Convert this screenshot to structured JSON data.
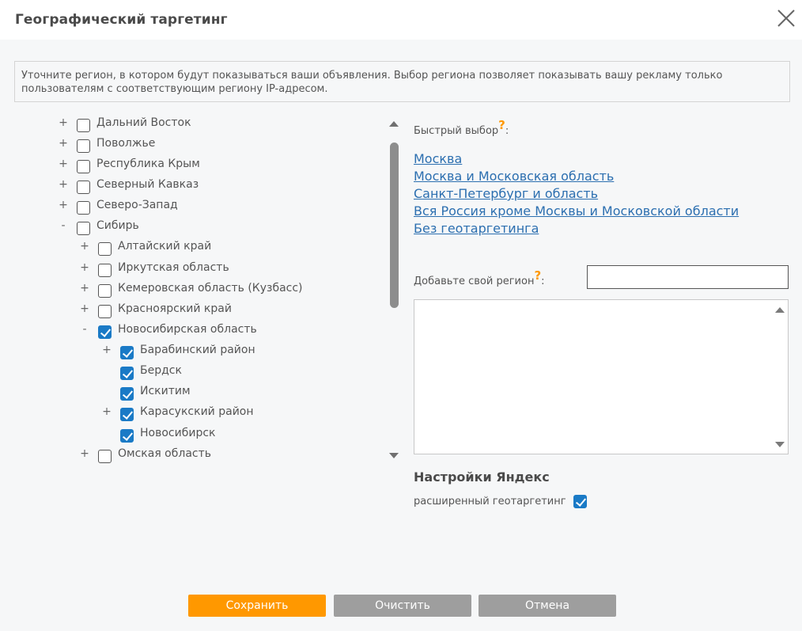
{
  "dialog": {
    "title": "Географический таргетинг",
    "info": "Уточните регион, в котором будут показываться ваши объявления. Выбор региона позволяет показывать вашу рекламу только пользователям с соответствующим региону IP-адресом."
  },
  "tree": [
    {
      "toggle": "+",
      "label": "Дальний Восток",
      "checked": false,
      "level": 0
    },
    {
      "toggle": "+",
      "label": "Поволжье",
      "checked": false,
      "level": 0
    },
    {
      "toggle": "+",
      "label": "Республика Крым",
      "checked": false,
      "level": 0
    },
    {
      "toggle": "+",
      "label": "Северный Кавказ",
      "checked": false,
      "level": 0
    },
    {
      "toggle": "+",
      "label": "Северо-Запад",
      "checked": false,
      "level": 0
    },
    {
      "toggle": "-",
      "label": "Сибирь",
      "checked": false,
      "level": 0
    },
    {
      "toggle": "+",
      "label": "Алтайский край",
      "checked": false,
      "level": 1
    },
    {
      "toggle": "+",
      "label": "Иркутская область",
      "checked": false,
      "level": 1
    },
    {
      "toggle": "+",
      "label": "Кемеровская область (Кузбасс)",
      "checked": false,
      "level": 1
    },
    {
      "toggle": "+",
      "label": "Красноярский край",
      "checked": false,
      "level": 1
    },
    {
      "toggle": "-",
      "label": "Новосибирская область",
      "checked": true,
      "level": 1
    },
    {
      "toggle": "+",
      "label": "Барабинский район",
      "checked": true,
      "level": 2
    },
    {
      "toggle": "",
      "label": "Бердск",
      "checked": true,
      "level": 2
    },
    {
      "toggle": "",
      "label": "Искитим",
      "checked": true,
      "level": 2
    },
    {
      "toggle": "+",
      "label": "Карасукский район",
      "checked": true,
      "level": 2
    },
    {
      "toggle": "",
      "label": "Новосибирск",
      "checked": true,
      "level": 2
    },
    {
      "toggle": "+",
      "label": "Омская область",
      "checked": false,
      "level": 1
    }
  ],
  "quick": {
    "label": "Быстрый выбор",
    "help": "?",
    "colon": ":",
    "links": [
      "Москва",
      "Москва и Московская область",
      "Санкт-Петербург и область",
      "Вся Россия кроме Москвы и Московской области",
      "Без геотаргетинга"
    ]
  },
  "add_region": {
    "label": "Добавьте свой регион",
    "help": "?",
    "colon": ":",
    "value": ""
  },
  "yandex": {
    "title": "Настройки Яндекс",
    "extended_label": "расширенный геотаргетинг",
    "extended_checked": true
  },
  "buttons": {
    "save": "Сохранить",
    "clear": "Очистить",
    "cancel": "Отмена"
  },
  "colors": {
    "accent": "#ff9800",
    "checkbox": "#1a7ac6",
    "link": "#2c6fb0",
    "button_gray": "#9e9e9e"
  }
}
